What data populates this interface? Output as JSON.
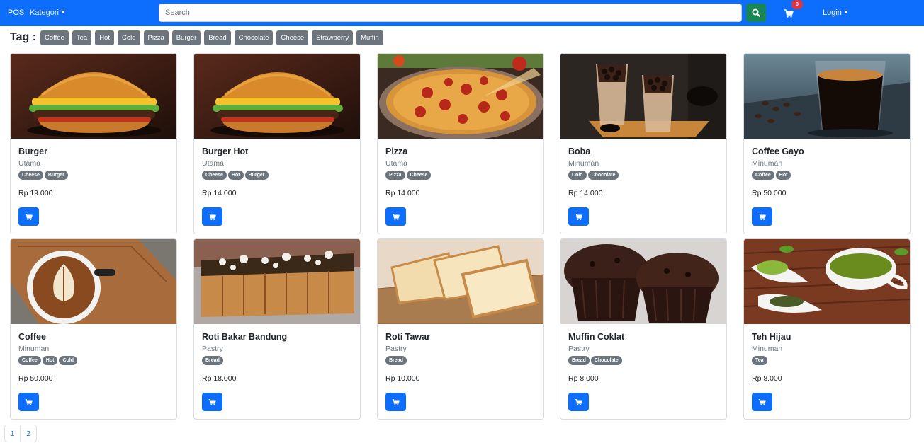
{
  "navbar": {
    "brand": "POS",
    "kategori": "Kategori",
    "search_placeholder": "Search",
    "cart_count": "0",
    "login": "Login"
  },
  "tags": {
    "title": "Tag :",
    "items": [
      "Coffee",
      "Tea",
      "Hot",
      "Cold",
      "Pizza",
      "Burger",
      "Bread",
      "Chocolate",
      "Cheese",
      "Strawberry",
      "Muffin"
    ]
  },
  "products": [
    {
      "name": "Burger",
      "category": "Utama",
      "tags": [
        "Cheese",
        "Burger"
      ],
      "price": "Rp 19.000",
      "image": "burger"
    },
    {
      "name": "Burger Hot",
      "category": "Utama",
      "tags": [
        "Cheese",
        "Hot",
        "Burger"
      ],
      "price": "Rp 14.000",
      "image": "burger"
    },
    {
      "name": "Pizza",
      "category": "Utama",
      "tags": [
        "Pizza",
        "Cheese"
      ],
      "price": "Rp 14.000",
      "image": "pizza"
    },
    {
      "name": "Boba",
      "category": "Minuman",
      "tags": [
        "Cold",
        "Chocolate"
      ],
      "price": "Rp 14.000",
      "image": "boba"
    },
    {
      "name": "Coffee Gayo",
      "category": "Minuman",
      "tags": [
        "Coffee",
        "Hot"
      ],
      "price": "Rp 50.000",
      "image": "coffee-glass"
    },
    {
      "name": "Coffee",
      "category": "Minuman",
      "tags": [
        "Coffee",
        "Hot",
        "Cold"
      ],
      "price": "Rp 50.000",
      "image": "latte"
    },
    {
      "name": "Roti Bakar Bandung",
      "category": "Pastry",
      "tags": [
        "Bread"
      ],
      "price": "Rp 18.000",
      "image": "roti-bakar"
    },
    {
      "name": "Roti Tawar",
      "category": "Pastry",
      "tags": [
        "Bread"
      ],
      "price": "Rp 10.000",
      "image": "bread"
    },
    {
      "name": "Muffin Coklat",
      "category": "Pastry",
      "tags": [
        "Bread",
        "Chocolate"
      ],
      "price": "Rp 8.000",
      "image": "muffin"
    },
    {
      "name": "Teh Hijau",
      "category": "Minuman",
      "tags": [
        "Tea"
      ],
      "price": "Rp 8.000",
      "image": "green-tea"
    }
  ],
  "pagination": [
    "1",
    "2"
  ],
  "colors": {
    "primary": "#0d6efd",
    "success": "#198754",
    "secondary": "#6c757d",
    "danger": "#dc3545"
  }
}
